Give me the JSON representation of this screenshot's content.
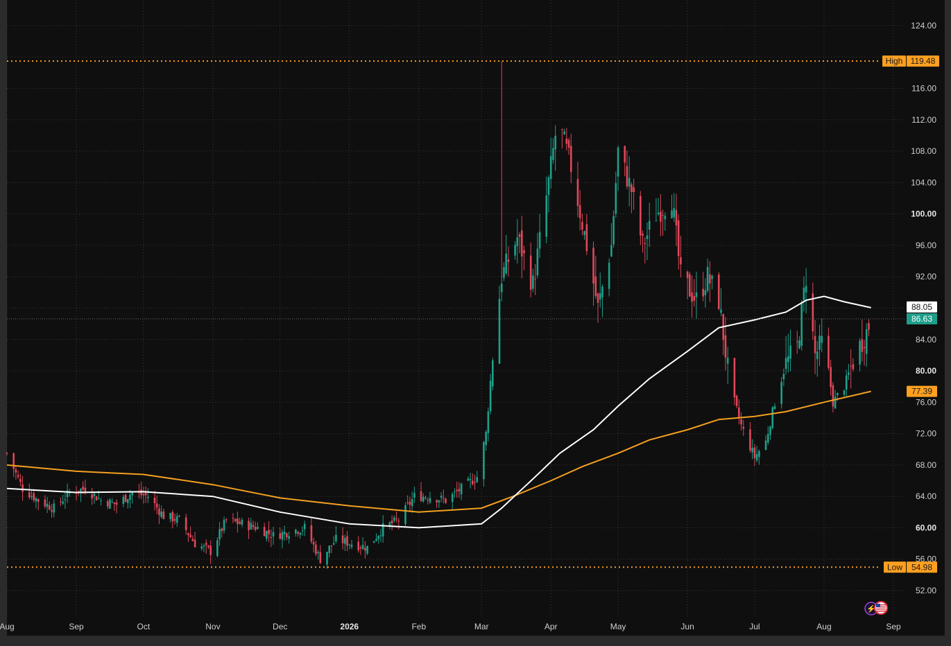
{
  "colors": {
    "background": "#0f0f0f",
    "frame": "#2b2b2b",
    "grid": "#3a3a3a",
    "up": "#1fa08a",
    "down": "#e0485a",
    "ma_white": "#ffffff",
    "ma_orange": "#f5a020",
    "high_low": "#ffa020",
    "last_price_bg": "#1e9e8a",
    "axis_text": "#d0d0d0"
  },
  "chart_data": {
    "type": "candlestick",
    "y_axis": {
      "range": [
        49,
        127
      ],
      "ticks": [
        {
          "value": 124,
          "label": "124.00",
          "bold": false
        },
        {
          "value": 116,
          "label": "116.00",
          "bold": false
        },
        {
          "value": 112,
          "label": "112.00",
          "bold": false
        },
        {
          "value": 108,
          "label": "108.00",
          "bold": false
        },
        {
          "value": 104,
          "label": "104.00",
          "bold": false
        },
        {
          "value": 100,
          "label": "100.00",
          "bold": true
        },
        {
          "value": 96,
          "label": "96.00",
          "bold": false
        },
        {
          "value": 92,
          "label": "92.00",
          "bold": false
        },
        {
          "value": 84,
          "label": "84.00",
          "bold": false
        },
        {
          "value": 80,
          "label": "80.00",
          "bold": true
        },
        {
          "value": 76,
          "label": "76.00",
          "bold": false
        },
        {
          "value": 72,
          "label": "72.00",
          "bold": false
        },
        {
          "value": 68,
          "label": "68.00",
          "bold": false
        },
        {
          "value": 64,
          "label": "64.00",
          "bold": false
        },
        {
          "value": 60,
          "label": "60.00",
          "bold": true
        },
        {
          "value": 56,
          "label": "56.00",
          "bold": false
        },
        {
          "value": 52,
          "label": "52.00",
          "bold": false
        }
      ]
    },
    "x_axis": {
      "range": [
        "2025-08-01",
        "2026-09-01"
      ],
      "ticks": [
        {
          "date": "2025-08-01",
          "label": "Aug",
          "bold": false
        },
        {
          "date": "2025-09-01",
          "label": "Sep",
          "bold": false
        },
        {
          "date": "2025-10-01",
          "label": "Oct",
          "bold": false
        },
        {
          "date": "2025-11-01",
          "label": "Nov",
          "bold": false
        },
        {
          "date": "2025-12-01",
          "label": "Dec",
          "bold": false
        },
        {
          "date": "2026-01-01",
          "label": "2026",
          "bold": true
        },
        {
          "date": "2026-02-01",
          "label": "Feb",
          "bold": false
        },
        {
          "date": "2026-03-01",
          "label": "Mar",
          "bold": false
        },
        {
          "date": "2026-04-01",
          "label": "Apr",
          "bold": false
        },
        {
          "date": "2026-05-01",
          "label": "May",
          "bold": false
        },
        {
          "date": "2026-06-01",
          "label": "Jun",
          "bold": false
        },
        {
          "date": "2026-07-01",
          "label": "Jul",
          "bold": false
        },
        {
          "date": "2026-08-01",
          "label": "Aug",
          "bold": false
        },
        {
          "date": "2026-09-01",
          "label": "Sep",
          "bold": false
        }
      ]
    },
    "high_line": {
      "label": "High",
      "value": 119.48,
      "value_label": "119.48"
    },
    "low_line": {
      "label": "Low",
      "value": 54.98,
      "value_label": "54.98"
    },
    "last_price": {
      "value": 86.63,
      "label": "86.63"
    },
    "ma_white_last": {
      "value": 88.05,
      "label": "88.05"
    },
    "ma_orange_last": {
      "value": 77.39,
      "label": "77.39"
    },
    "price_path": [
      [
        "2025-08-01",
        69.5
      ],
      [
        "2025-08-08",
        65.0
      ],
      [
        "2025-08-15",
        63.5
      ],
      [
        "2025-08-22",
        62.5
      ],
      [
        "2025-08-29",
        64.5
      ],
      [
        "2025-09-05",
        65.0
      ],
      [
        "2025-09-12",
        63.5
      ],
      [
        "2025-09-19",
        63.0
      ],
      [
        "2025-09-26",
        64.5
      ],
      [
        "2025-10-03",
        64.0
      ],
      [
        "2025-10-10",
        61.5
      ],
      [
        "2025-10-17",
        61.0
      ],
      [
        "2025-10-24",
        58.0
      ],
      [
        "2025-10-31",
        57.0
      ],
      [
        "2025-11-07",
        61.0
      ],
      [
        "2025-11-14",
        60.5
      ],
      [
        "2025-11-21",
        60.0
      ],
      [
        "2025-11-28",
        59.0
      ],
      [
        "2025-12-05",
        59.5
      ],
      [
        "2025-12-12",
        60.0
      ],
      [
        "2025-12-19",
        56.0
      ],
      [
        "2025-12-26",
        58.5
      ],
      [
        "2026-01-02",
        58.0
      ],
      [
        "2026-01-09",
        57.5
      ],
      [
        "2026-01-16",
        60.0
      ],
      [
        "2026-01-23",
        61.0
      ],
      [
        "2026-01-30",
        64.0
      ],
      [
        "2026-02-06",
        64.0
      ],
      [
        "2026-02-13",
        63.5
      ],
      [
        "2026-02-20",
        65.0
      ],
      [
        "2026-02-27",
        66.5
      ],
      [
        "2026-03-03",
        72.0
      ],
      [
        "2026-03-06",
        82.0
      ],
      [
        "2026-03-10",
        92.0
      ],
      [
        "2026-03-17",
        97.0
      ],
      [
        "2026-03-24",
        91.0
      ],
      [
        "2026-03-31",
        104.0
      ],
      [
        "2026-04-04",
        112.0
      ],
      [
        "2026-04-10",
        106.0
      ],
      [
        "2026-04-17",
        96.0
      ],
      [
        "2026-04-22",
        88.0
      ],
      [
        "2026-04-28",
        96.0
      ],
      [
        "2026-05-01",
        108.0
      ],
      [
        "2026-05-07",
        103.0
      ],
      [
        "2026-05-12",
        96.0
      ],
      [
        "2026-05-18",
        100.0
      ],
      [
        "2026-05-25",
        102.0
      ],
      [
        "2026-05-29",
        92.0
      ],
      [
        "2026-06-05",
        89.0
      ],
      [
        "2026-06-10",
        92.0
      ],
      [
        "2026-06-15",
        89.0
      ],
      [
        "2026-06-20",
        78.0
      ],
      [
        "2026-06-25",
        73.0
      ],
      [
        "2026-07-01",
        69.0
      ],
      [
        "2026-07-06",
        71.0
      ],
      [
        "2026-07-10",
        76.0
      ],
      [
        "2026-07-15",
        81.0
      ],
      [
        "2026-07-20",
        83.0
      ],
      [
        "2026-07-24",
        92.0
      ],
      [
        "2026-07-28",
        82.0
      ],
      [
        "2026-08-01",
        84.0
      ],
      [
        "2026-08-05",
        76.0
      ],
      [
        "2026-08-10",
        78.0
      ],
      [
        "2026-08-15",
        82.0
      ],
      [
        "2026-08-20",
        85.0
      ],
      [
        "2026-08-22",
        86.63
      ]
    ],
    "ma_white_path": [
      [
        "2025-08-01",
        65.0
      ],
      [
        "2025-09-01",
        64.5
      ],
      [
        "2025-10-01",
        64.6
      ],
      [
        "2025-11-01",
        64.0
      ],
      [
        "2025-12-01",
        62.0
      ],
      [
        "2026-01-01",
        60.5
      ],
      [
        "2026-02-01",
        60.0
      ],
      [
        "2026-03-01",
        60.5
      ],
      [
        "2026-03-10",
        62.5
      ],
      [
        "2026-03-25",
        66.5
      ],
      [
        "2026-04-05",
        69.5
      ],
      [
        "2026-04-20",
        72.5
      ],
      [
        "2026-05-01",
        75.5
      ],
      [
        "2026-05-15",
        79.0
      ],
      [
        "2026-06-01",
        82.5
      ],
      [
        "2026-06-15",
        85.5
      ],
      [
        "2026-07-01",
        86.5
      ],
      [
        "2026-07-15",
        87.5
      ],
      [
        "2026-07-24",
        89.0
      ],
      [
        "2026-08-01",
        89.5
      ],
      [
        "2026-08-10",
        88.8
      ],
      [
        "2026-08-22",
        88.05
      ]
    ],
    "ma_orange_path": [
      [
        "2025-08-01",
        68.0
      ],
      [
        "2025-09-01",
        67.2
      ],
      [
        "2025-10-01",
        66.8
      ],
      [
        "2025-11-01",
        65.5
      ],
      [
        "2025-12-01",
        63.8
      ],
      [
        "2026-01-01",
        62.8
      ],
      [
        "2026-02-01",
        62.0
      ],
      [
        "2026-03-01",
        62.5
      ],
      [
        "2026-03-15",
        64.0
      ],
      [
        "2026-04-01",
        66.0
      ],
      [
        "2026-04-15",
        67.8
      ],
      [
        "2026-05-01",
        69.5
      ],
      [
        "2026-05-15",
        71.2
      ],
      [
        "2026-06-01",
        72.5
      ],
      [
        "2026-06-15",
        73.8
      ],
      [
        "2026-07-01",
        74.2
      ],
      [
        "2026-07-15",
        74.8
      ],
      [
        "2026-08-01",
        76.0
      ],
      [
        "2026-08-22",
        77.39
      ]
    ]
  }
}
